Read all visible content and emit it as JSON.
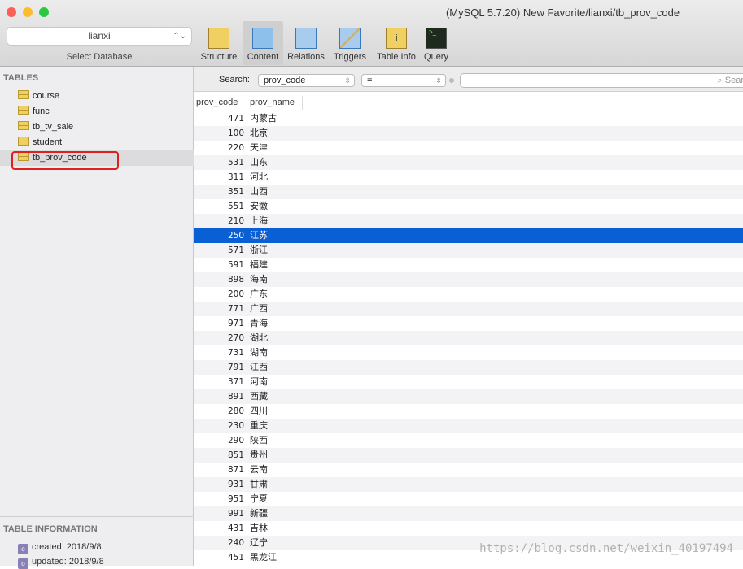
{
  "window": {
    "title": "(MySQL 5.7.20) New Favorite/lianxi/tb_prov_code"
  },
  "database": {
    "selected": "lianxi",
    "label": "Select Database"
  },
  "toolbar": [
    {
      "label": "Structure",
      "icon": "structure-icon"
    },
    {
      "label": "Content",
      "icon": "content-icon",
      "active": true
    },
    {
      "label": "Relations",
      "icon": "relations-icon"
    },
    {
      "label": "Triggers",
      "icon": "triggers-icon"
    },
    {
      "label": "Table Info",
      "icon": "table-info-icon"
    },
    {
      "label": "Query",
      "icon": "query-icon"
    }
  ],
  "sidebar": {
    "tables_heading": "TABLES",
    "tables": [
      "course",
      "func",
      "tb_tv_sale",
      "student",
      "tb_prov_code"
    ],
    "selected": "tb_prov_code",
    "info_heading": "TABLE INFORMATION",
    "info": [
      "created: 2018/9/8",
      "updated: 2018/9/8"
    ]
  },
  "search": {
    "label": "Search:",
    "field": "prov_code",
    "operator": "=",
    "value": "",
    "placeholder": "Sear"
  },
  "table": {
    "columns": [
      "prov_code",
      "prov_name"
    ],
    "selected_row": 8,
    "rows": [
      [
        "471",
        "内蒙古"
      ],
      [
        "100",
        "北京"
      ],
      [
        "220",
        "天津"
      ],
      [
        "531",
        "山东"
      ],
      [
        "311",
        "河北"
      ],
      [
        "351",
        "山西"
      ],
      [
        "551",
        "安徽"
      ],
      [
        "210",
        "上海"
      ],
      [
        "250",
        "江苏"
      ],
      [
        "571",
        "浙江"
      ],
      [
        "591",
        "福建"
      ],
      [
        "898",
        "海南"
      ],
      [
        "200",
        "广东"
      ],
      [
        "771",
        "广西"
      ],
      [
        "971",
        "青海"
      ],
      [
        "270",
        "湖北"
      ],
      [
        "731",
        "湖南"
      ],
      [
        "791",
        "江西"
      ],
      [
        "371",
        "河南"
      ],
      [
        "891",
        "西藏"
      ],
      [
        "280",
        "四川"
      ],
      [
        "230",
        "重庆"
      ],
      [
        "290",
        "陕西"
      ],
      [
        "851",
        "贵州"
      ],
      [
        "871",
        "云南"
      ],
      [
        "931",
        "甘肃"
      ],
      [
        "951",
        "宁夏"
      ],
      [
        "991",
        "新疆"
      ],
      [
        "431",
        "吉林"
      ],
      [
        "240",
        "辽宁"
      ],
      [
        "451",
        "黑龙江"
      ]
    ]
  },
  "watermark": "https://blog.csdn.net/weixin_40197494",
  "colors": {
    "selection": "#0a5fd4",
    "highlight_border": "#e0201c"
  }
}
